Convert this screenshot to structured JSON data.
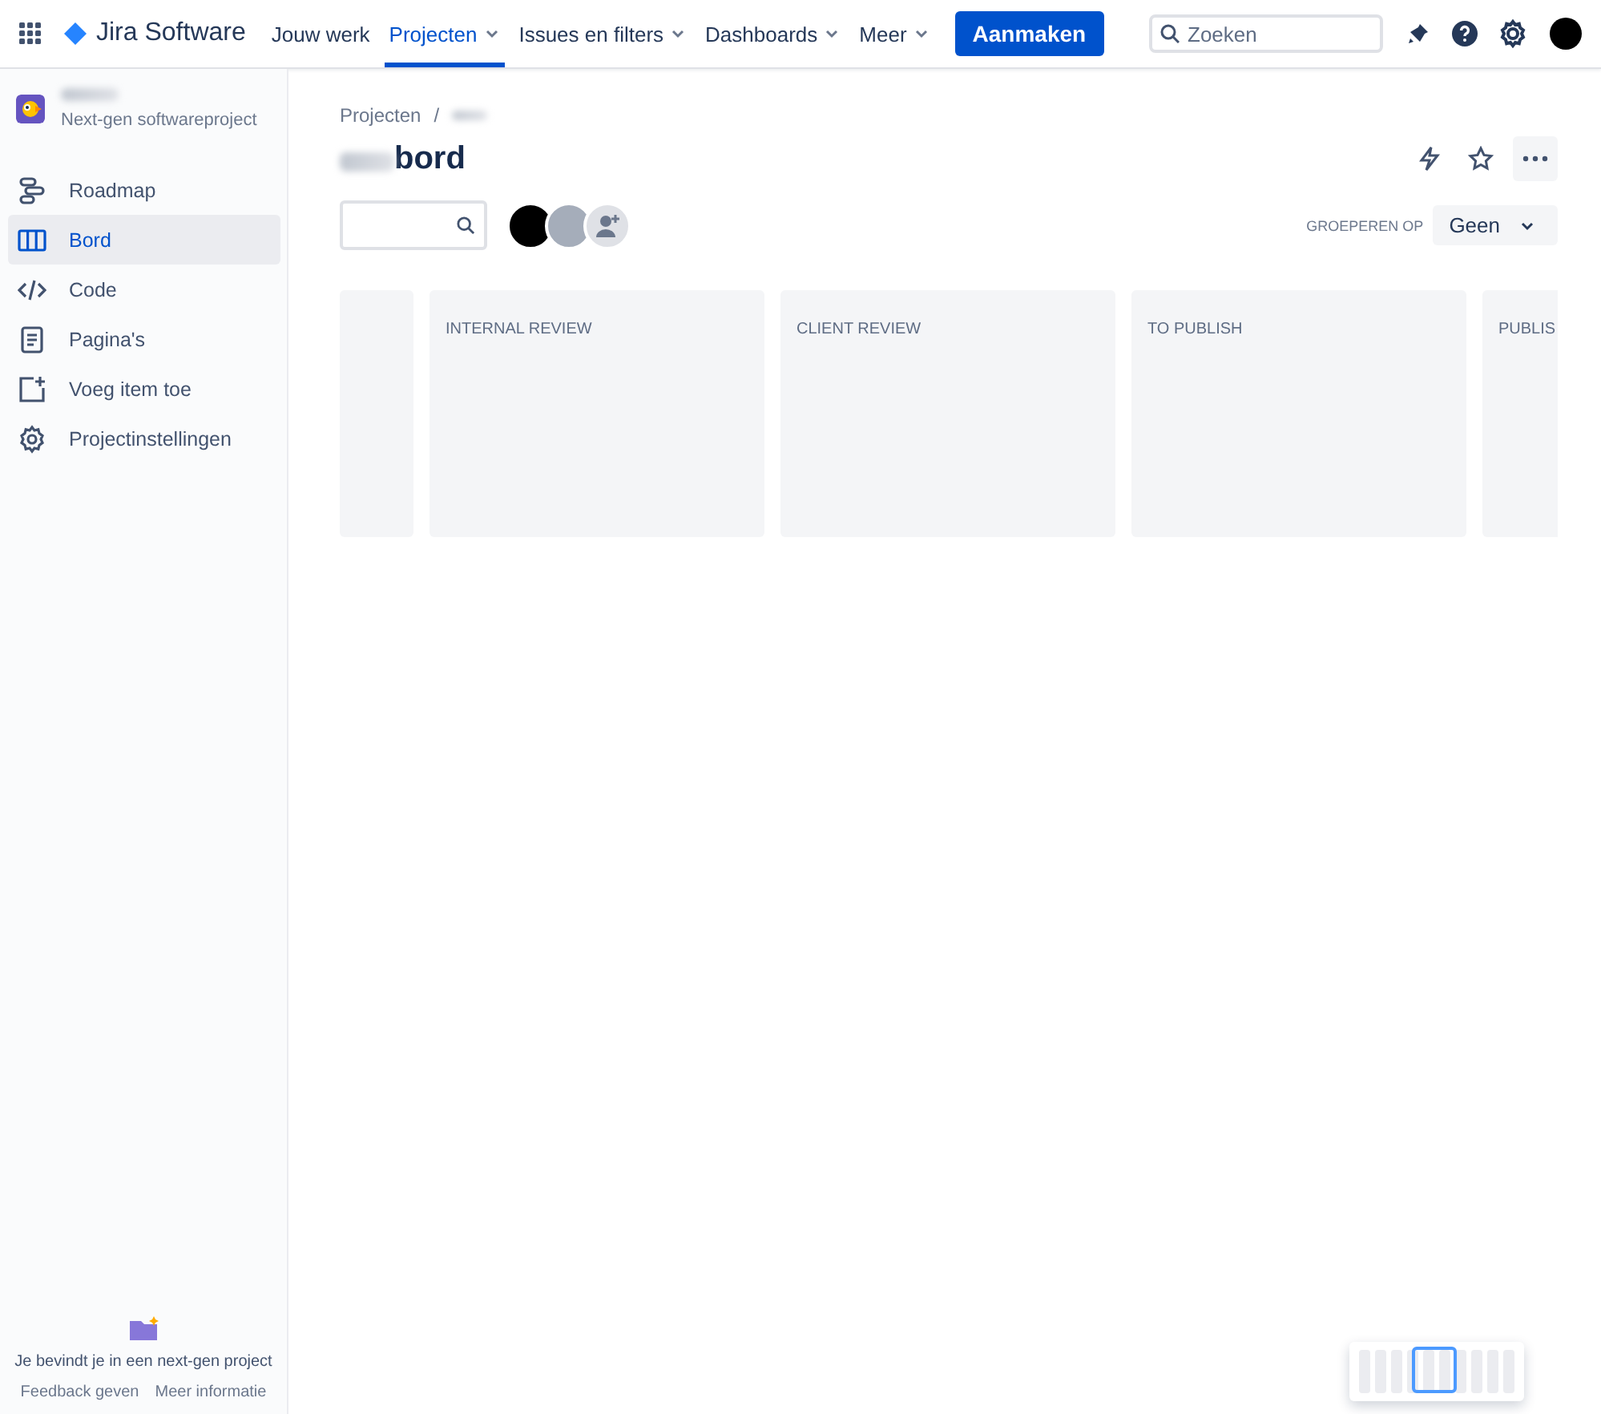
{
  "top_nav": {
    "product": "Jira Software",
    "items": [
      {
        "label": "Jouw werk",
        "dropdown": false,
        "selected": false
      },
      {
        "label": "Projecten",
        "dropdown": true,
        "selected": true
      },
      {
        "label": "Issues en filters",
        "dropdown": true,
        "selected": false
      },
      {
        "label": "Dashboards",
        "dropdown": true,
        "selected": false
      },
      {
        "label": "Meer",
        "dropdown": true,
        "selected": false
      }
    ],
    "create_button": "Aanmaken",
    "search": {
      "placeholder": "Zoeken"
    }
  },
  "sidebar": {
    "project_type": "Next-gen softwareproject",
    "items": [
      {
        "label": "Roadmap",
        "kind": "roadmap",
        "selected": false
      },
      {
        "label": "Bord",
        "kind": "board",
        "selected": true
      },
      {
        "label": "Code",
        "kind": "code",
        "selected": false
      },
      {
        "label": "Pagina's",
        "kind": "page",
        "selected": false
      },
      {
        "label": "Voeg item toe",
        "kind": "add",
        "selected": false
      },
      {
        "label": "Projectinstellingen",
        "kind": "settings",
        "selected": false
      }
    ],
    "footer": {
      "message": "Je bevindt je in een next-gen project",
      "links": [
        "Feedback geven",
        "Meer informatie"
      ]
    }
  },
  "main": {
    "breadcrumb": "Projecten",
    "breadcrumb_separator": "/",
    "title": "bord",
    "group_by": {
      "label": "GROEPEREN OP",
      "value": "Geen"
    },
    "columns": [
      {},
      {
        "title": "INTERNAL REVIEW"
      },
      {
        "title": "CLIENT REVIEW"
      },
      {
        "title": "TO PUBLISH"
      },
      {
        "title": "PUBLIS"
      }
    ]
  }
}
